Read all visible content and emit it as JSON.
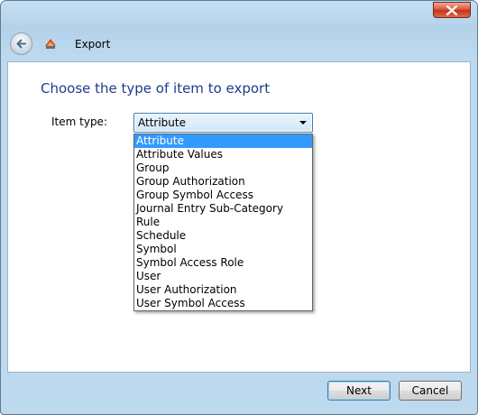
{
  "window": {
    "title": "Export"
  },
  "page": {
    "heading": "Choose the type of item to export",
    "item_type_label": "Item type:"
  },
  "combo": {
    "selected": "Attribute",
    "options": [
      "Attribute",
      "Attribute Values",
      "Group",
      "Group Authorization",
      "Group Symbol Access",
      "Journal Entry Sub-Category",
      "Rule",
      "Schedule",
      "Symbol",
      "Symbol Access Role",
      "User",
      "User Authorization",
      "User Symbol Access"
    ]
  },
  "buttons": {
    "next": "Next",
    "cancel": "Cancel"
  },
  "icons": {
    "close": "close-icon",
    "back": "back-arrow-icon",
    "app": "export-app-icon",
    "dropdown": "chevron-down-icon"
  },
  "colors": {
    "heading": "#1e3c8a",
    "selection": "#3399ff",
    "close_button": "#c2321a"
  }
}
